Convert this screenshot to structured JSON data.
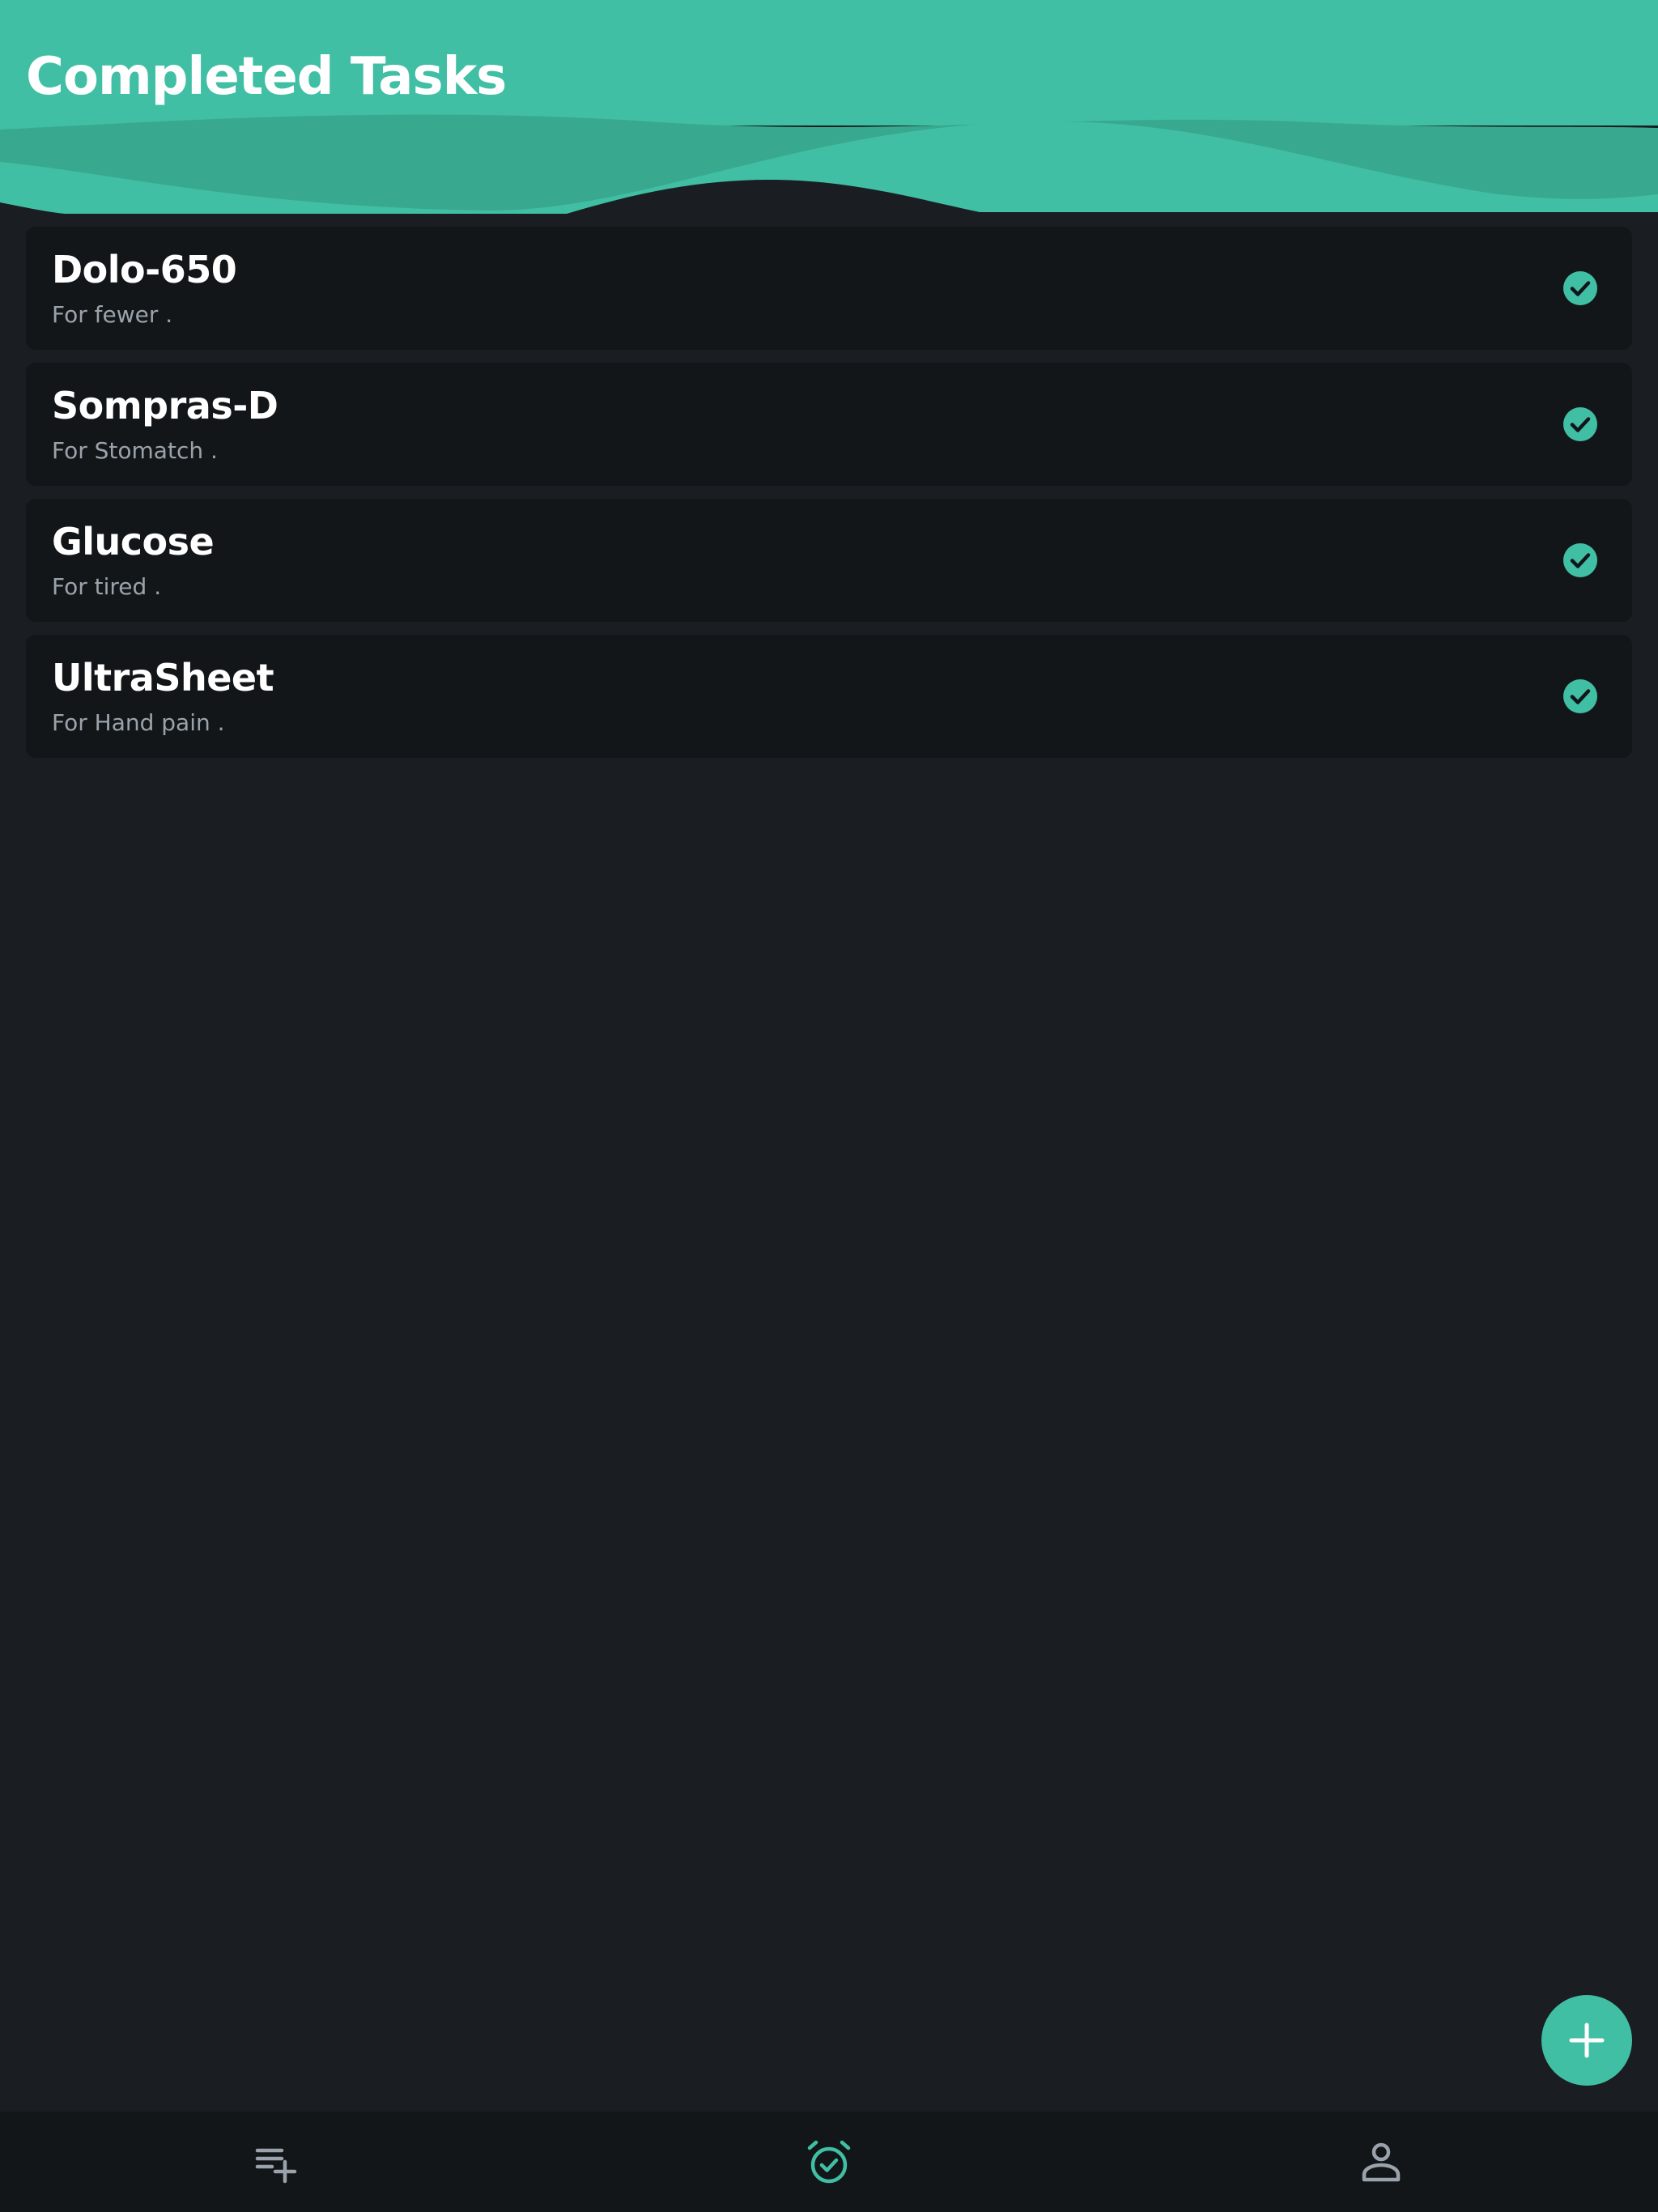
{
  "header": {
    "title": "Completed Tasks"
  },
  "tasks": [
    {
      "name": "Dolo-650",
      "description": "For fewer  ."
    },
    {
      "name": "Sompras-D",
      "description": "For Stomatch  ."
    },
    {
      "name": "Glucose",
      "description": "For tired  ."
    },
    {
      "name": "UltraSheet",
      "description": "For Hand pain  ."
    }
  ],
  "icons": {
    "task_status": "check-circle-icon",
    "fab": "plus-icon",
    "nav": [
      "playlist-add-icon",
      "alarm-check-icon",
      "person-icon"
    ]
  },
  "colors": {
    "accent": "#40bfa4",
    "accent_dark": "#35a38b",
    "background": "#1a1e22",
    "card": "#131619",
    "nav_inactive": "#9aa3ab"
  }
}
